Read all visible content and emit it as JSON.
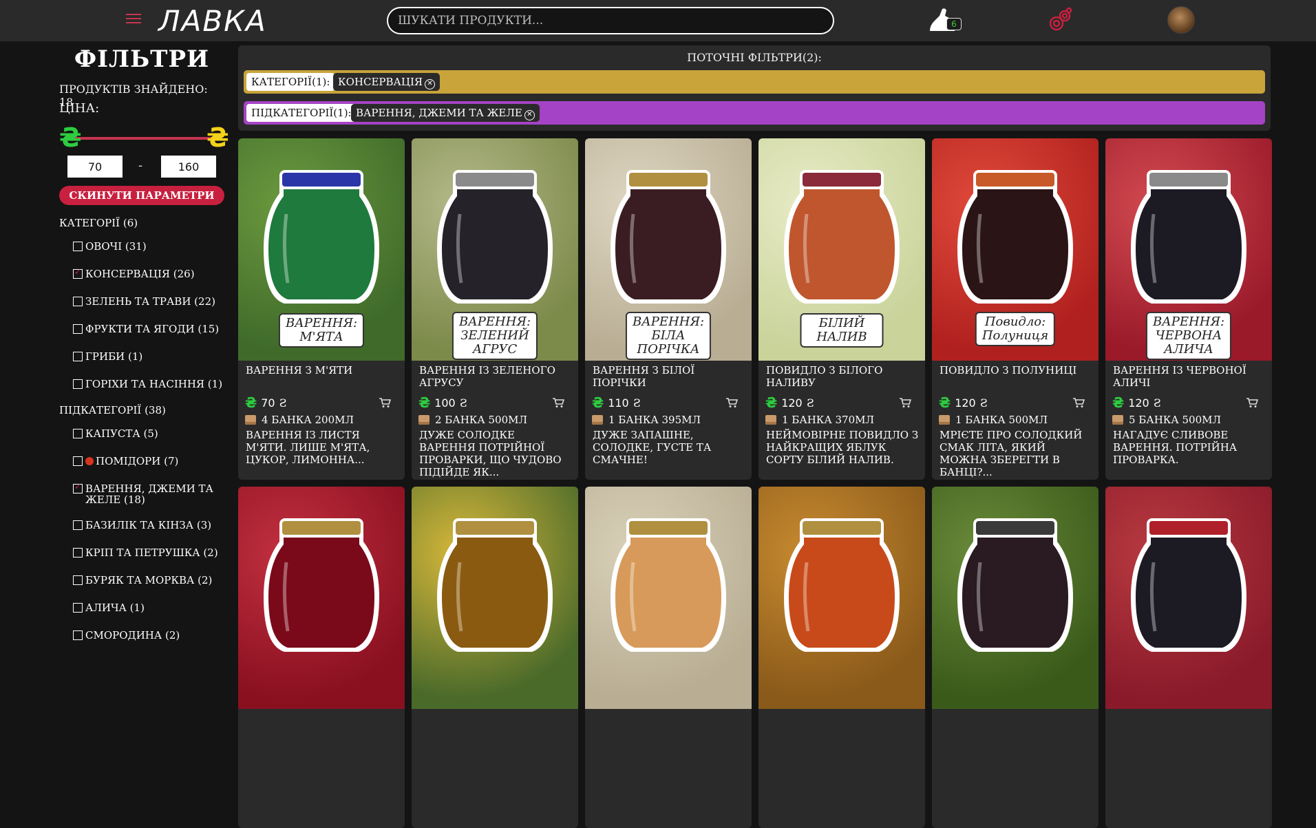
{
  "header": {
    "logo": "ЛАВКА",
    "search_placeholder": "ШУКАТИ ПРОДУКТИ...",
    "cart_count": "6",
    "icons": [
      "menu-icon",
      "cart-icon",
      "compare-icon",
      "avatar"
    ]
  },
  "sidebar": {
    "title": "ФІЛЬТРИ",
    "found": "ПРОДУКТІВ ЗНАЙДЕНО: 18",
    "price_label": "ЦІНА:",
    "currency": "₴",
    "price_min": "70",
    "price_max": "160",
    "dash": "-",
    "reset": "СКИНУТИ ПАРАМЕТРИ",
    "categories_title": "КАТЕГОРІЇ (6)",
    "categories": [
      {
        "label": "ОВОЧІ (31)",
        "checked": false
      },
      {
        "label": "КОНСЕРВАЦІЯ (26)",
        "checked": true
      },
      {
        "label": "ЗЕЛЕНЬ ТА ТРАВИ (22)",
        "checked": false
      },
      {
        "label": "ФРУКТИ ТА ЯГОДИ (15)",
        "checked": false
      },
      {
        "label": "ГРИБИ (1)",
        "checked": false
      },
      {
        "label": "ГОРІХИ ТА НАСІННЯ (1)",
        "checked": false
      }
    ],
    "subcategories_title": "ПІДКАТЕГОРІЇ (38)",
    "subcategories": [
      {
        "label": "КАПУСТА (5)",
        "checked": false
      },
      {
        "label": "ПОМІДОРИ (7)",
        "checked": false
      },
      {
        "label": "ВАРЕННЯ, ДЖЕМИ ТА ЖЕЛЕ (18)",
        "checked": true
      },
      {
        "label": "БАЗИЛІК ТА КІНЗА (3)",
        "checked": false
      },
      {
        "label": "КРІП ТА ПЕТРУШКА (2)",
        "checked": false
      },
      {
        "label": "БУРЯК ТА МОРКВА (2)",
        "checked": false
      },
      {
        "label": "АЛИЧА (1)",
        "checked": false
      },
      {
        "label": "СМОРОДИНА (2)",
        "checked": false
      }
    ]
  },
  "current_filters": {
    "title": "ПОТОЧНІ ФІЛЬТРИ(2):",
    "category_label": "КАТЕГОРІЇ(1):",
    "category_chip": "КОНСЕРВАЦІЯ",
    "subcategory_label": "ПІДКАТЕГОРІЇ(1):",
    "subcategory_chip": "ВАРЕННЯ, ДЖЕМИ ТА ЖЕЛЕ",
    "colors": {
      "category_bar": "#c8a43a",
      "subcategory_bar": "#a443c5"
    }
  },
  "products": [
    {
      "title": "ВАРЕННЯ З М'ЯТИ",
      "price": "70",
      "unit": "Ƨ",
      "stock": "4 БАНКА 200МЛ",
      "desc": "ВАРЕННЯ ІЗ ЛИСТЯ М'ЯТИ. ЛИШЕ М'ЯТА, ЦУКОР, ЛИМОННА...",
      "img_label": "ВАРЕННЯ: М'ЯТА",
      "bg": "#3f6a2a",
      "bg2": "#6b9a3e",
      "jar": "#1f7a3d",
      "lid": "#2a36a8"
    },
    {
      "title": "ВАРЕННЯ ІЗ ЗЕЛЕНОГО АГРУСУ",
      "price": "100",
      "unit": "Ƨ",
      "stock": "2 БАНКА 500МЛ",
      "desc": "ДУЖЕ СОЛОДКЕ ВАРЕННЯ ПОТРІЙНОЇ ПРОВАРКИ, ЩО ЧУДОВО ПІДІЙДЕ ЯК...",
      "img_label": "ВАРЕННЯ:\nЗЕЛЕНИЙ АГРУС",
      "bg": "#7c8a4a",
      "bg2": "#b5b98a",
      "jar": "#262229",
      "lid": "#8a8a8a"
    },
    {
      "title": "ВАРЕННЯ З БІЛОЇ ПОРІЧКИ",
      "price": "110",
      "unit": "Ƨ",
      "stock": "1 БАНКА 395МЛ",
      "desc": "ДУЖЕ ЗАПАШНЕ, СОЛОДКЕ, ГУСТЕ ТА СМАЧНЕ!",
      "img_label": "ВАРЕННЯ:\nБІЛА ПОРІЧКА",
      "bg": "#b9ae94",
      "bg2": "#ded6c2",
      "jar": "#3a1d22",
      "lid": "#b09040"
    },
    {
      "title": "ПОВИДЛО З БІЛОГО НАЛИВУ",
      "price": "120",
      "unit": "Ƨ",
      "stock": "1 БАНКА 370МЛ",
      "desc": "НЕЙМОВІРНЕ ПОВИДЛО З НАЙКРАЩИХ ЯБЛУК СОРТУ БІЛИЙ НАЛИВ.",
      "img_label": "БІЛИЙ НАЛИВ",
      "bg": "#c9d39a",
      "bg2": "#e8ebc6",
      "jar": "#c0562e",
      "lid": "#8a2a3a"
    },
    {
      "title": "ПОВИДЛО З ПОЛУНИЦІ",
      "price": "120",
      "unit": "Ƨ",
      "stock": "1 БАНКА 500МЛ",
      "desc": "МРІЄТЕ ПРО СОЛОДКИЙ СМАК ЛІТА, ЯКИЙ МОЖНА ЗБЕРЕГТИ В БАНЦІ?...",
      "img_label": "Повидло:\nПолуниця",
      "bg": "#b0201e",
      "bg2": "#e04a3a",
      "jar": "#2a1416",
      "lid": "#c85a2a"
    },
    {
      "title": "ВАРЕННЯ ІЗ ЧЕРВОНОЇ АЛИЧІ",
      "price": "120",
      "unit": "Ƨ",
      "stock": "5 БАНКА 500МЛ",
      "desc": "НАГАДУЄ СЛИВОВЕ ВАРЕННЯ. ПОТРІЙНА ПРОВАРКА.",
      "img_label": "ВАРЕННЯ:\nЧЕРВОНА АЛИЧА",
      "bg": "#9a1a2a",
      "bg2": "#d24a50",
      "jar": "#1c1a22",
      "lid": "#8a8a8a"
    },
    {
      "title": "",
      "price": "",
      "unit": "",
      "stock": "",
      "desc": "",
      "img_label": "",
      "bg": "#8a1020",
      "bg2": "#c23040",
      "jar": "#7a0a1a",
      "lid": "#b09040"
    },
    {
      "title": "",
      "price": "",
      "unit": "",
      "stock": "",
      "desc": "",
      "img_label": "",
      "bg": "#4a6a2a",
      "bg2": "#d8b83a",
      "jar": "#8a5a10",
      "lid": "#b09040"
    },
    {
      "title": "",
      "price": "",
      "unit": "",
      "stock": "",
      "desc": "",
      "img_label": "",
      "bg": "#b9ae94",
      "bg2": "#d8d0b8",
      "jar": "#d89a5a",
      "lid": "#b09040"
    },
    {
      "title": "",
      "price": "",
      "unit": "",
      "stock": "",
      "desc": "",
      "img_label": "",
      "bg": "#8a5a1a",
      "bg2": "#c88a30",
      "jar": "#c84a1a",
      "lid": "#b09040"
    },
    {
      "title": "",
      "price": "",
      "unit": "",
      "stock": "",
      "desc": "",
      "img_label": "",
      "bg": "#3a5a1a",
      "bg2": "#6a8a3a",
      "jar": "#2a1a22",
      "lid": "#3a3a3a"
    },
    {
      "title": "",
      "price": "",
      "unit": "",
      "stock": "",
      "desc": "",
      "img_label": "",
      "bg": "#8a1a2a",
      "bg2": "#b83a40",
      "jar": "#1c1a22",
      "lid": "#b0202a"
    }
  ]
}
